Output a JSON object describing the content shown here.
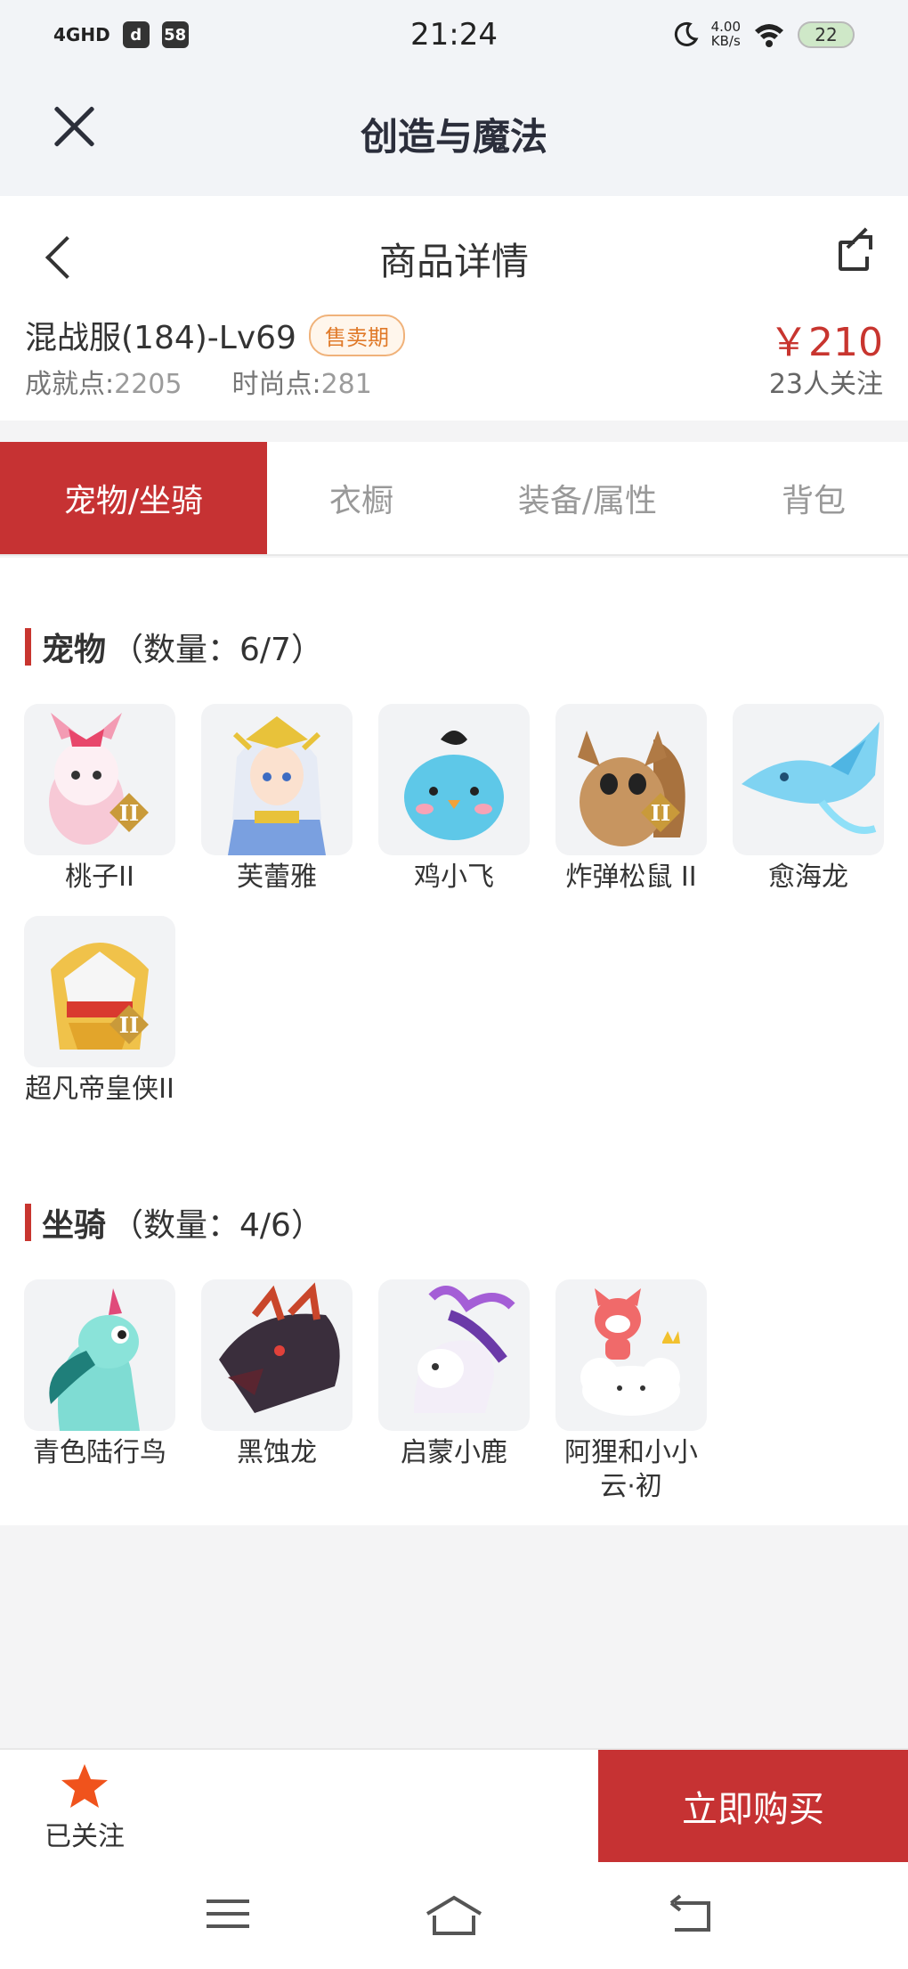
{
  "status_bar": {
    "network": "4GHD",
    "box1": "d",
    "box2": "58",
    "time": "21:24",
    "speed_value": "4.00",
    "speed_unit": "KB/s",
    "battery": "22"
  },
  "app_bar": {
    "title": "创造与魔法"
  },
  "header": {
    "page_title": "商品详情",
    "product_name": "混战服(184)-Lv69",
    "sale_badge": "售卖期",
    "achievement_label": "成就点:",
    "achievement_value": "2205",
    "fashion_label": "时尚点:",
    "fashion_value": "281",
    "price": "￥210",
    "followers": "23人关注"
  },
  "tabs": [
    {
      "label": "宠物/坐骑",
      "active": true
    },
    {
      "label": "衣橱",
      "active": false
    },
    {
      "label": "装备/属性",
      "active": false
    },
    {
      "label": "背包",
      "active": false
    }
  ],
  "pets": {
    "title": "宠物",
    "count": "（数量：6/7）",
    "items": [
      {
        "name": "桃子II",
        "icon": "pink-cat-pet-icon"
      },
      {
        "name": "芙蕾雅",
        "icon": "valkyrie-pet-icon"
      },
      {
        "name": "鸡小飞",
        "icon": "blue-bird-pet-icon"
      },
      {
        "name": "炸弹松鼠 II",
        "icon": "bomb-squirrel-pet-icon"
      },
      {
        "name": "愈海龙",
        "icon": "sea-dragon-pet-icon"
      },
      {
        "name": "超凡帝皇侠II",
        "icon": "golden-knight-pet-icon"
      }
    ]
  },
  "mounts": {
    "title": "坐骑",
    "count": "（数量：4/6）",
    "items": [
      {
        "name": "青色陆行鸟",
        "icon": "cyan-bird-mount-icon"
      },
      {
        "name": "黑蚀龙",
        "icon": "black-dragon-mount-icon"
      },
      {
        "name": "启蒙小鹿",
        "icon": "white-deer-mount-icon"
      },
      {
        "name": "阿狸和小小云·初",
        "icon": "ali-cloud-mount-icon"
      }
    ]
  },
  "bottom_bar": {
    "follow_label": "已关注",
    "buy_label": "立即购买"
  },
  "colors": {
    "accent": "#c63233",
    "price": "#c8352f",
    "badge": "#e07a2a",
    "star": "#f0531c"
  }
}
